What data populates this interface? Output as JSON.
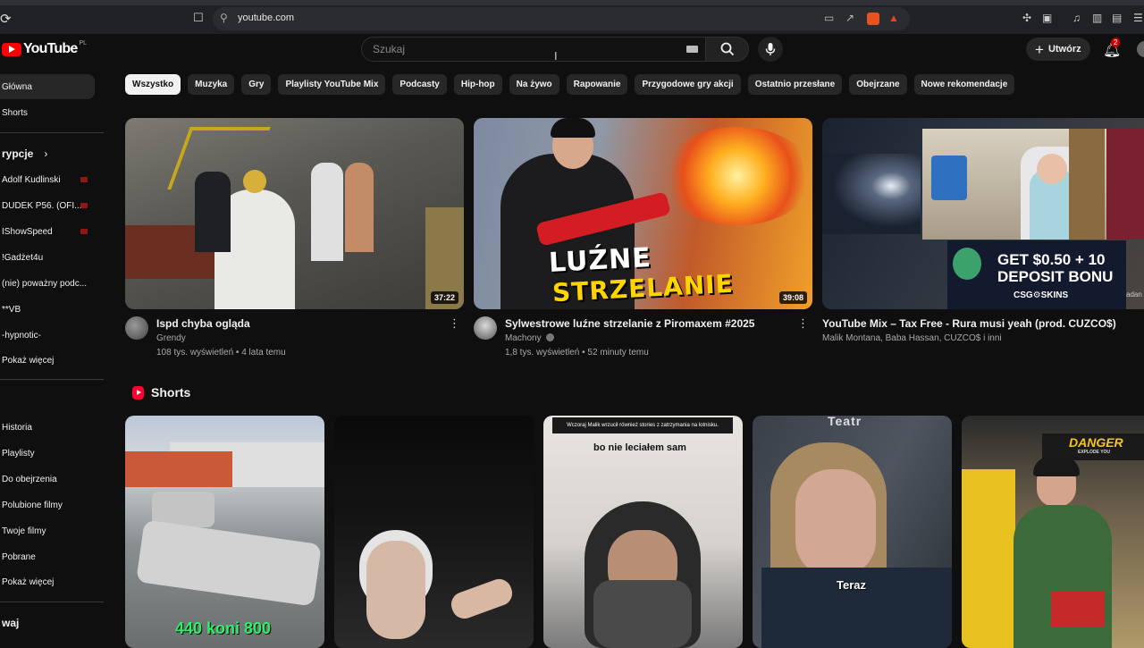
{
  "browser": {
    "url": "youtube.com"
  },
  "header": {
    "logo_text": "YouTube",
    "region": "PL",
    "search_placeholder": "Szukaj",
    "create_label": "Utwórz",
    "notif_count": "2"
  },
  "sidebar": {
    "home": "Główna",
    "shorts": "Shorts",
    "subs_heading": "rypcje",
    "subscriptions": [
      {
        "label": "Adolf Kudlinski",
        "live": true
      },
      {
        "label": "DUDEK P56. (OFI...",
        "live": true
      },
      {
        "label": "IShowSpeed",
        "live": true
      },
      {
        "label": "!Gadżet4u",
        "live": false
      },
      {
        "label": "(nie) poważny podc...",
        "live": false
      },
      {
        "label": "**VB",
        "live": false
      },
      {
        "label": "-hypnotic-",
        "live": false
      }
    ],
    "show_more_subs": "Pokaż więcej",
    "you_items": [
      "Historia",
      "Playlisty",
      "Do obejrzenia",
      "Polubione filmy",
      "Twoje filmy",
      "Pobrane"
    ],
    "show_more_you": "Pokaż więcej",
    "bottom_heading": "waj"
  },
  "chips": [
    "Wszystko",
    "Muzyka",
    "Gry",
    "Playlisty YouTube Mix",
    "Podcasty",
    "Hip-hop",
    "Na żywo",
    "Rapowanie",
    "Przygodowe gry akcji",
    "Ostatnio przesłane",
    "Obejrzane",
    "Nowe rekomendacje"
  ],
  "videos": [
    {
      "title": "Ispd chyba ogląda",
      "channel": "Grendy",
      "stats": "108 tys. wyświetleń • 4 lata temu",
      "duration": "37:22"
    },
    {
      "title": "Sylwestrowe luźne strzelanie z Piromaxem #2025",
      "channel": "Machony",
      "stats": "1,8 tys. wyświetleń • 52 minuty temu",
      "duration": "39:08",
      "thumb_line1": "LUŹNE",
      "thumb_line2": "STRZELANIE"
    },
    {
      "title": "YouTube Mix – Tax Free - Rura musi yeah (prod. CUZCO$)",
      "channel": "Malik Montana, Baba Hassan, CUZCO$ i inni",
      "stats": "",
      "ad_line1": "GET $0.50 + 10",
      "ad_line2": "DEPOSIT BONU",
      "ad_brand": "CSG⚙SKINS",
      "ad_side": "adan"
    }
  ],
  "shorts_section": {
    "title": "Shorts",
    "items": [
      {
        "overlay": "440 koni 800"
      },
      {
        "overlay": ""
      },
      {
        "top_note": "Wczoraj Malik wrzucił również stories z zatrzymania na lotnisku.",
        "overlay": "bo nie leciałem sam"
      },
      {
        "top_text": "Teatr",
        "overlay": "Teraz"
      },
      {
        "overlay": "DANGER",
        "sub": "EXPLODE YOU"
      }
    ]
  },
  "colors": {
    "background": "#0f0f0f",
    "chip": "#272727",
    "brand_red": "#ff0000"
  }
}
